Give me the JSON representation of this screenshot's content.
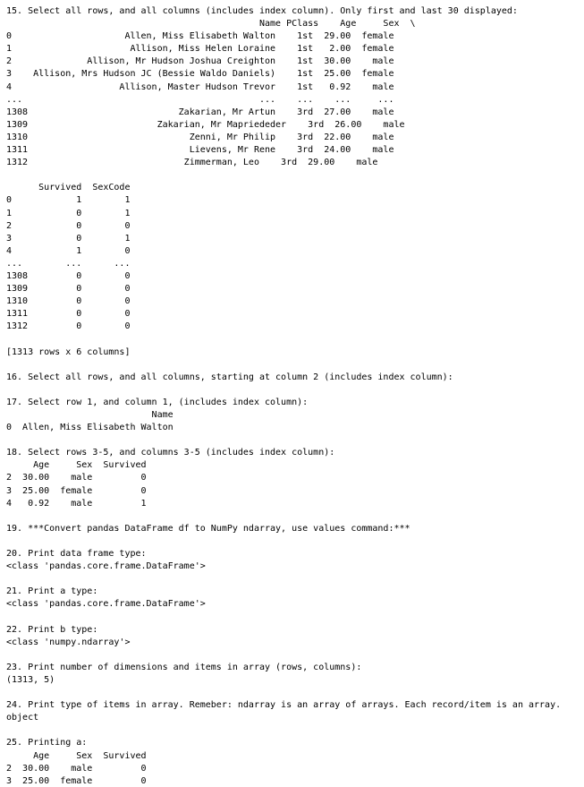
{
  "console": {
    "lines": [
      "15. Select all rows, and all columns (includes index column). Only first and last 30 displayed:",
      "                                               Name PClass    Age     Sex  \\",
      "0                     Allen, Miss Elisabeth Walton    1st  29.00  female",
      "1                      Allison, Miss Helen Loraine    1st   2.00  female",
      "2              Allison, Mr Hudson Joshua Creighton    1st  30.00    male",
      "3    Allison, Mrs Hudson JC (Bessie Waldo Daniels)    1st  25.00  female",
      "4                    Allison, Master Hudson Trevor    1st   0.92    male",
      "...                                            ...    ...    ...     ...",
      "1308                            Zakarian, Mr Artun    3rd  27.00    male",
      "1309                        Zakarian, Mr Mapriededer    3rd  26.00    male",
      "1310                              Zenni, Mr Philip    3rd  22.00    male",
      "1311                              Lievens, Mr Rene    3rd  24.00    male",
      "1312                             Zimmerman, Leo    3rd  29.00    male",
      "",
      "      Survived  SexCode",
      "0            1        1",
      "1            0        1",
      "2            0        0",
      "3            0        1",
      "4            1        0",
      "...        ...      ...",
      "1308         0        0",
      "1309         0        0",
      "1310         0        0",
      "1311         0        0",
      "1312         0        0",
      "",
      "[1313 rows x 6 columns]",
      "",
      "16. Select all rows, and all columns, starting at column 2 (includes index column):",
      "",
      "17. Select row 1, and column 1, (includes index column):",
      "                           Name",
      "0  Allen, Miss Elisabeth Walton",
      "",
      "18. Select rows 3-5, and columns 3-5 (includes index column):",
      "     Age     Sex  Survived",
      "2  30.00    male         0",
      "3  25.00  female         0",
      "4   0.92    male         1",
      "",
      "19. ***Convert pandas DataFrame df to NumPy ndarray, use values command:***",
      "",
      "20. Print data frame type:",
      "<class 'pandas.core.frame.DataFrame'>",
      "",
      "21. Print a type:",
      "<class 'pandas.core.frame.DataFrame'>",
      "",
      "22. Print b type:",
      "<class 'numpy.ndarray'>",
      "",
      "23. Print number of dimensions and items in array (rows, columns):",
      "(1313, 5)",
      "",
      "24. Print type of items in array. Remeber: ndarray is an array of arrays. Each record/item is an array.",
      "object",
      "",
      "25. Printing a:",
      "     Age     Sex  Survived",
      "2  30.00    male         0",
      "3  25.00  female         0"
    ]
  }
}
